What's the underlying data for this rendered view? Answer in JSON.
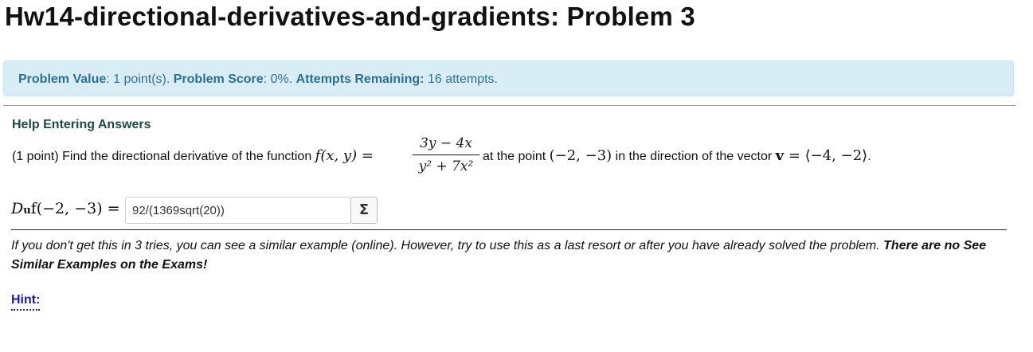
{
  "page": {
    "title": "Hw14-directional-derivatives-and-gradients: Problem 3"
  },
  "info_bar": {
    "value_label": "Problem Value",
    "value_text": ": 1 point(s). ",
    "score_label": "Problem Score",
    "score_text": ": 0%. ",
    "attempts_label": "Attempts Remaining:",
    "attempts_text": " 16 attempts."
  },
  "problem": {
    "help_link": "Help Entering Answers",
    "prefix": "(1 point) Find the directional derivative of the function ",
    "func": "f(x, y)",
    "eq": " = ",
    "numerator": "3y − 4x",
    "denominator": "y² + 7x²",
    "at_point_text": " at the point ",
    "point": "(−2, −3)",
    "direction_text": " in the direction of the vector ",
    "vector": "v",
    "vector_value": " = ⟨−4, −2⟩",
    "end": "."
  },
  "answer": {
    "label_D": "D",
    "label_u": "u",
    "label_rest": "f(−2, −3) = ",
    "value": "92/(1369sqrt(20))",
    "equation_editor": "Σ"
  },
  "note": {
    "text": "If you don't get this in 3 tries, you can see a similar example (online). However, try to use this as a last resort or after you have already solved the problem. ",
    "bold_text": "There are no See Similar Examples on the Exams!"
  },
  "hint": {
    "label": "Hint:"
  }
}
